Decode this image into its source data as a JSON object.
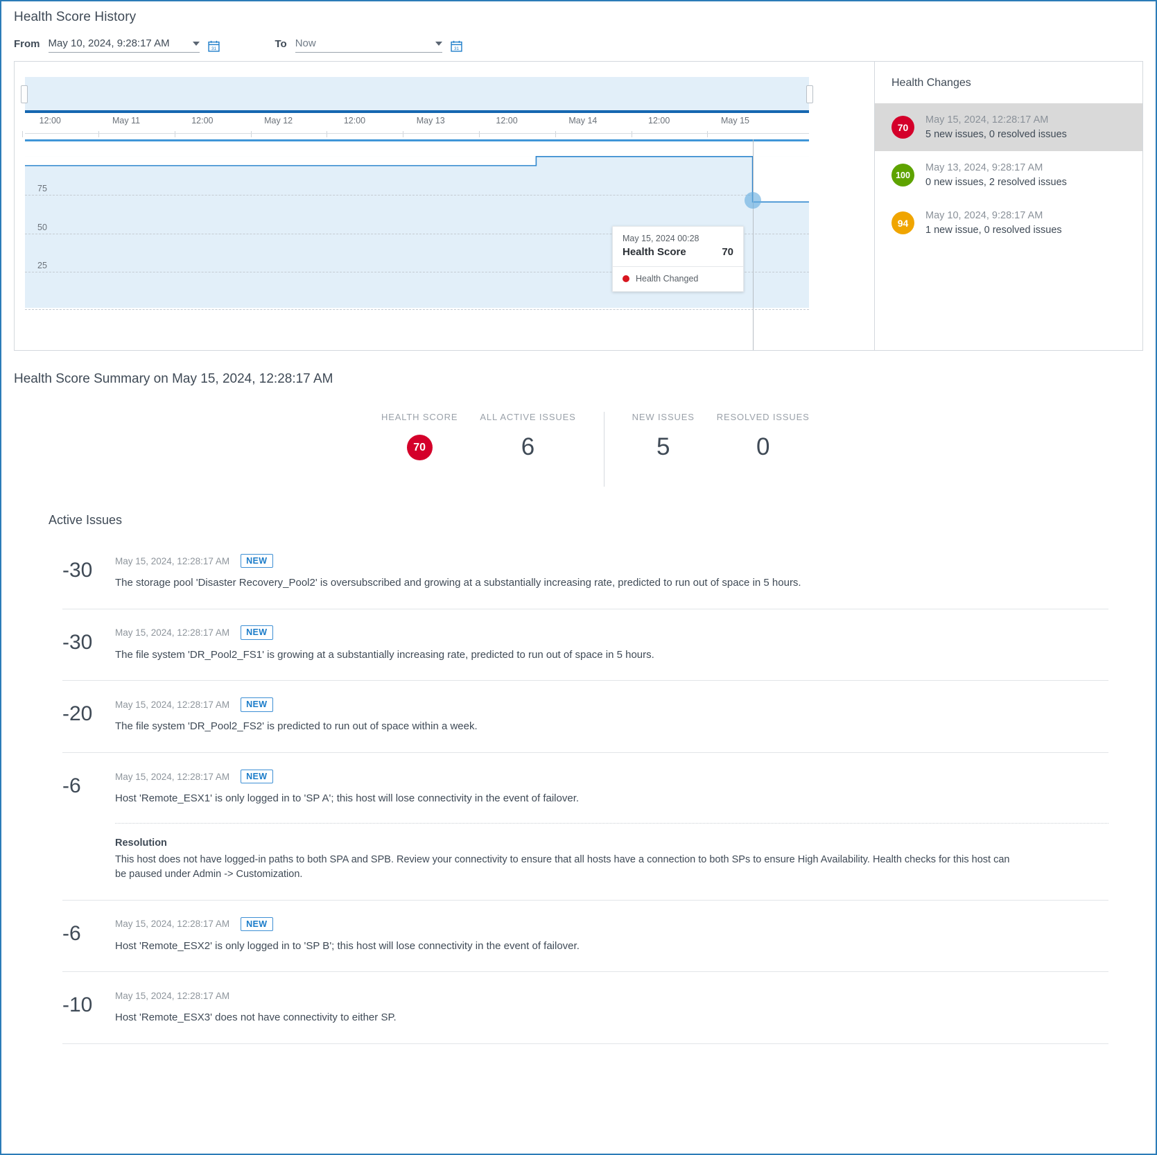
{
  "panel": {
    "title": "Health Score History"
  },
  "filters": {
    "from_label": "From",
    "from_value": "May 10, 2024, 9:28:17 AM",
    "to_label": "To",
    "to_value": "Now",
    "calendar_icon": "calendar-icon"
  },
  "chart_data": {
    "type": "line",
    "title": "Health Score History",
    "xlabel": "",
    "ylabel": "Health Score",
    "ylim": [
      0,
      100
    ],
    "yticks": [
      25,
      50,
      75
    ],
    "xticks": [
      "12:00",
      "May 11",
      "12:00",
      "May 12",
      "12:00",
      "May 13",
      "12:00",
      "May 14",
      "12:00",
      "May 15"
    ],
    "grid": true,
    "series": [
      {
        "name": "Health Score",
        "points": [
          {
            "x": "May 10, 2024 9:28",
            "y": 94
          },
          {
            "x": "May 13, 2024 9:28",
            "y": 94
          },
          {
            "x": "May 13, 2024 9:28",
            "y": 100
          },
          {
            "x": "May 15, 2024 0:28",
            "y": 100
          },
          {
            "x": "May 15, 2024 0:28",
            "y": 70
          },
          {
            "x": "Now",
            "y": 70
          }
        ]
      }
    ],
    "events": [
      {
        "label": "May 10, 2024, 9:28:17 AM",
        "score": 94,
        "color": "#f0a500",
        "position_pct": 1.8
      },
      {
        "label": "May 13, 2024, 9:28:17 AM",
        "score": 100,
        "color": "#5ea300",
        "position_pct": 65.2
      },
      {
        "label": "May 15, 2024, 12:28:17 AM",
        "score": 70,
        "color": "#d8161f",
        "position_pct": 92.8,
        "selected": true
      }
    ],
    "tooltip": {
      "date": "May 15, 2024 00:28",
      "metric_name": "Health Score",
      "metric_value": "70",
      "legend_label": "Health Changed",
      "legend_color": "#d8161f"
    }
  },
  "health_changes": {
    "title": "Health Changes",
    "items": [
      {
        "score": "70",
        "color": "#d4002a",
        "date": "May 15, 2024, 12:28:17 AM",
        "summary": "5 new issues, 0 resolved issues",
        "selected": true
      },
      {
        "score": "100",
        "color": "#5ea300",
        "date": "May 13, 2024, 9:28:17 AM",
        "summary": "0 new issues, 2 resolved issues",
        "selected": false
      },
      {
        "score": "94",
        "color": "#f0a500",
        "date": "May 10, 2024, 9:28:17 AM",
        "summary": "1 new issue, 0 resolved issues",
        "selected": false
      }
    ]
  },
  "summary": {
    "title": "Health Score Summary on May 15, 2024, 12:28:17 AM",
    "metrics": [
      {
        "label": "HEALTH SCORE",
        "value": "70",
        "is_pill": true,
        "color": "#d4002a"
      },
      {
        "label": "ALL ACTIVE ISSUES",
        "value": "6",
        "is_pill": false
      },
      {
        "label": "NEW ISSUES",
        "value": "5",
        "is_pill": false
      },
      {
        "label": "RESOLVED ISSUES",
        "value": "0",
        "is_pill": false
      }
    ]
  },
  "active_issues": {
    "title": "Active Issues",
    "new_tag": "NEW",
    "resolution_title": "Resolution",
    "items": [
      {
        "score": "-30",
        "time": "May 15, 2024, 12:28:17 AM",
        "is_new": true,
        "description": "The storage pool 'Disaster Recovery_Pool2' is oversubscribed and growing at a substantially increasing rate, predicted to run out of space in 5 hours."
      },
      {
        "score": "-30",
        "time": "May 15, 2024, 12:28:17 AM",
        "is_new": true,
        "description": "The file system 'DR_Pool2_FS1' is growing at a substantially increasing rate, predicted to run out of space in 5 hours."
      },
      {
        "score": "-20",
        "time": "May 15, 2024, 12:28:17 AM",
        "is_new": true,
        "description": "The file system 'DR_Pool2_FS2' is predicted to run out of space within a week."
      },
      {
        "score": "-6",
        "time": "May 15, 2024, 12:28:17 AM",
        "is_new": true,
        "description": "Host 'Remote_ESX1' is only logged in to 'SP A'; this host will lose connectivity in the event of failover.",
        "resolution": "This host does not have logged-in paths to both SPA and SPB. Review your connectivity to ensure that all hosts have a connection to both SPs to ensure High Availability. Health checks for this host can be paused under Admin -> Customization."
      },
      {
        "score": "-6",
        "time": "May 15, 2024, 12:28:17 AM",
        "is_new": true,
        "description": "Host 'Remote_ESX2' is only logged in to 'SP B'; this host will lose connectivity in the event of failover."
      },
      {
        "score": "-10",
        "time": "May 15, 2024, 12:28:17 AM",
        "is_new": false,
        "description": "Host 'Remote_ESX3' does not have connectivity to either SP."
      }
    ]
  }
}
